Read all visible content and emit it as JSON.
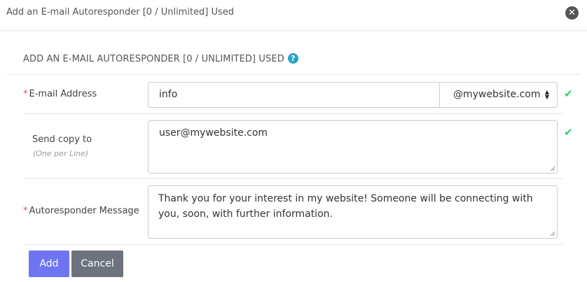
{
  "dialog": {
    "title": "Add an E-mail Autoresponder [0 / Unlimited] Used",
    "close_icon": "close-icon"
  },
  "section": {
    "title": "ADD AN E-MAIL AUTORESPONDER [0 / UNLIMITED] USED",
    "help_glyph": "?"
  },
  "form": {
    "email": {
      "required_mark": "*",
      "label": "E-mail Address",
      "value": "info",
      "domain": "@mywebsite.com"
    },
    "copy_to": {
      "label": "Send copy to",
      "hint": "(One per Line)",
      "value": "user@mywebsite.com"
    },
    "message": {
      "required_mark": "*",
      "label": "Autoresponder Message",
      "value": "Thank you for your interest in my website! Someone will be connecting with you, soon, with further information."
    },
    "valid_glyph": "✔"
  },
  "buttons": {
    "add_label": "Add",
    "cancel_label": "Cancel"
  },
  "colors": {
    "add_button": "#6f74f2",
    "cancel_button": "#6c737c",
    "valid_check": "#2ecc71",
    "help_icon": "#2aa3c7",
    "required": "#d9534f"
  }
}
